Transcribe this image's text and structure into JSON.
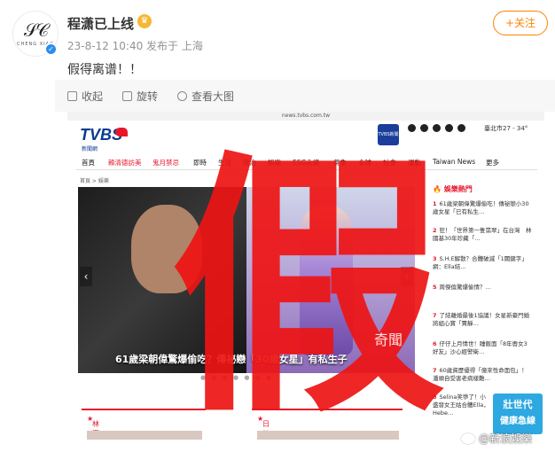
{
  "post": {
    "username": "程潇已上线",
    "avatar_mono": "𝒮𝒞",
    "avatar_text": "CHENG XIAO",
    "meta": "23-8-12 10:40 发布于 上海",
    "follow_label": "+关注",
    "text": "假得离谱！！"
  },
  "toolbar": {
    "shrink": "收起",
    "rotate": "旋转",
    "view_large": "查看大图"
  },
  "screenshot": {
    "url": "news.tvbs.com.tw",
    "logo_text": "TVBS",
    "logo_sub": "新聞網",
    "app_badge": "TVBS新聞",
    "weather": "臺北市27 - 34°",
    "breadcrumb": "首頁 > 娛樂",
    "nav": [
      "首頁",
      "賴清德訪美",
      "鬼月禁忌",
      "即時",
      "生活",
      "政治",
      "娛樂",
      "ESG永續",
      "氣象",
      "全球",
      "社會",
      "運動",
      "Taiwan News",
      "更多"
    ],
    "hero_caption": "61歲梁朝偉驚爆偷吃？傳祕戀「30歲女星」有私生子",
    "sidebar_title": "娛樂熱門",
    "sidebar_items": [
      {
        "num": "1",
        "text": "61歲梁朝偉驚爆偷吃！傳祕戀小30歲女星「已有私生…"
      },
      {
        "num": "2",
        "text": "狂！「世界第一隻翡翠」在台灣　林國基30年珍藏「…"
      },
      {
        "num": "3",
        "text": "S.H.E解散？合體破滅「1關鍵字」　網：Ella結…"
      },
      {
        "num": "5",
        "text": "周傑倫驚爆偷情？…"
      },
      {
        "num": "7",
        "text": "了結離婚最後1協議！女星新豪門婚　將組心寶「賈靜…"
      },
      {
        "num": "6",
        "text": "仔仔上月情世！睡飯面「8年轡女3好友」沙心經警衛…"
      },
      {
        "num": "7",
        "text": "60歲資歷優得「億來性命面包」！潘順自受害老病樣難…"
      },
      {
        "num": "8",
        "text": "Selina笑慘了！小盛發女王姑合體Ella，Hebe…"
      }
    ],
    "bottom_left": "林襄爆熱戀",
    "bottom_right": "日韓爆米花",
    "ad_line1": "壯世代",
    "ad_line2": "健康急線"
  },
  "overlays": {
    "fake_char": "假",
    "small_watermark": "奇聞",
    "site_watermark": "@新浪娛樂"
  }
}
